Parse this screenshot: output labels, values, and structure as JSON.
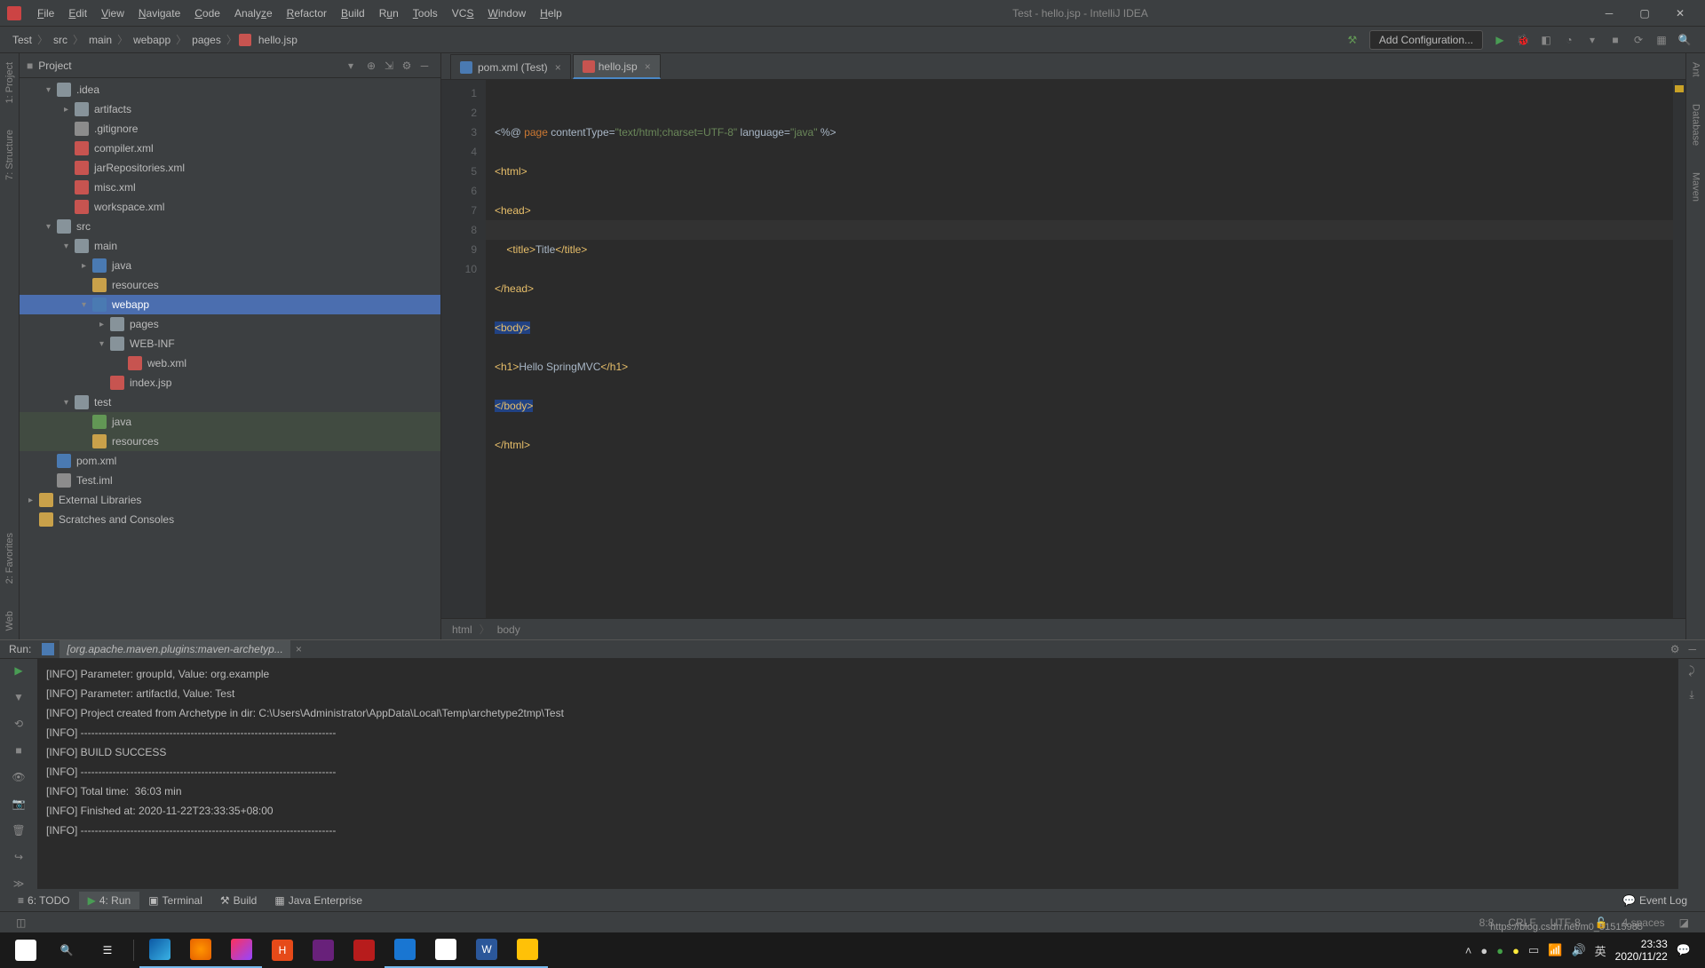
{
  "title": "Test - hello.jsp - IntelliJ IDEA",
  "menu": [
    "File",
    "Edit",
    "View",
    "Navigate",
    "Code",
    "Analyze",
    "Refactor",
    "Build",
    "Run",
    "Tools",
    "VCS",
    "Window",
    "Help"
  ],
  "breadcrumb": [
    "Test",
    "src",
    "main",
    "webapp",
    "pages",
    "hello.jsp"
  ],
  "add_config": "Add Configuration...",
  "project_label": "Project",
  "tree": {
    "idea": ".idea",
    "artifacts": "artifacts",
    "gitignore": ".gitignore",
    "compiler": "compiler.xml",
    "jarrepo": "jarRepositories.xml",
    "misc": "misc.xml",
    "workspace": "workspace.xml",
    "src": "src",
    "main": "main",
    "java": "java",
    "resources": "resources",
    "webapp": "webapp",
    "pages": "pages",
    "webinf": "WEB-INF",
    "webxml": "web.xml",
    "indexjsp": "index.jsp",
    "test": "test",
    "java2": "java",
    "resources2": "resources",
    "pom": "pom.xml",
    "testiml": "Test.iml",
    "extlib": "External Libraries",
    "scratches": "Scratches and Consoles"
  },
  "tabs": {
    "pom": "pom.xml (Test)",
    "hello": "hello.jsp"
  },
  "gutter_lines": [
    "1",
    "2",
    "3",
    "4",
    "5",
    "6",
    "7",
    "8",
    "9",
    "10"
  ],
  "code": {
    "l1a": "<%@ ",
    "l1b": "page",
    "l1c": " contentType=",
    "l1d": "\"text/html;charset=UTF-8\"",
    "l1e": " language=",
    "l1f": "\"java\"",
    "l1g": " %>",
    "l2": "<html>",
    "l3": "<head>",
    "l4a": "    <title>",
    "l4b": "Title",
    "l4c": "</title>",
    "l5": "</head>",
    "l6": "<body>",
    "l7a": "<h1>",
    "l7b": "Hello SpringMVC",
    "l7c": "</h1>",
    "l8": "</body>",
    "l9": "</html>"
  },
  "bc2": {
    "a": "html",
    "b": "body"
  },
  "run": {
    "label": "Run:",
    "tab": "[org.apache.maven.plugins:maven-archetyp...",
    "lines": [
      "[INFO] Parameter: groupId, Value: org.example",
      "[INFO] Parameter: artifactId, Value: Test",
      "[INFO] Project created from Archetype in dir: C:\\Users\\Administrator\\AppData\\Local\\Temp\\archetype2tmp\\Test",
      "[INFO] ------------------------------------------------------------------------",
      "[INFO] BUILD SUCCESS",
      "[INFO] ------------------------------------------------------------------------",
      "[INFO] Total time:  36:03 min",
      "[INFO] Finished at: 2020-11-22T23:33:35+08:00",
      "[INFO] ------------------------------------------------------------------------"
    ]
  },
  "bottom": {
    "todo": "6: TODO",
    "run": "4: Run",
    "terminal": "Terminal",
    "build": "Build",
    "jee": "Java Enterprise",
    "eventlog": "Event Log"
  },
  "status": {
    "pos": "8:8",
    "sep": "CRLF",
    "enc": "UTF-8",
    "spaces": "4 spaces"
  },
  "left_tools": {
    "project": "1: Project",
    "structure": "7: Structure"
  },
  "right_tools": {
    "ant": "Ant",
    "db": "Database",
    "maven": "Maven"
  },
  "bottom_left_tools": {
    "fav": "2: Favorites",
    "web": "Web"
  },
  "clock": {
    "time": "23:33",
    "date": "2020/11/22"
  },
  "watermark": "https://blog.csdn.net/m0_51515985"
}
